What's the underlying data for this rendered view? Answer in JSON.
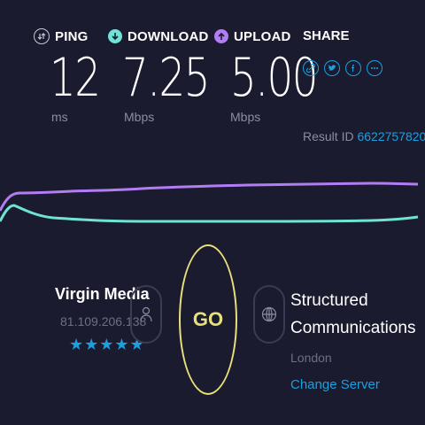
{
  "metrics": {
    "ping": {
      "label": "PING",
      "value": "12",
      "unit": "ms",
      "icon": "ping-icon"
    },
    "download": {
      "label": "DOWNLOAD",
      "value": "7.25",
      "unit": "Mbps",
      "icon": "download-arrow-icon"
    },
    "upload": {
      "label": "UPLOAD",
      "value": "5.00",
      "unit": "Mbps",
      "icon": "upload-arrow-icon"
    }
  },
  "share": {
    "label": "SHARE",
    "icons": [
      "link-icon",
      "twitter-icon",
      "facebook-icon",
      "more-icon"
    ]
  },
  "result": {
    "label": "Result ID",
    "id": "6622757820"
  },
  "isp": {
    "name": "Virgin Media",
    "ip": "81.109.206.138",
    "stars": "★★★★★",
    "rating": 5,
    "icon": "person-icon"
  },
  "go": {
    "label": "GO"
  },
  "server": {
    "name_line1": "Structured",
    "name_line2": "Communications",
    "location": "London",
    "change_label": "Change Server",
    "icon": "globe-icon"
  },
  "colors": {
    "background": "#1a1b2e",
    "download_line": "#6fe3d6",
    "upload_line": "#b27cf5",
    "accent": "#1c9fe0",
    "go": "#e8e07a"
  }
}
